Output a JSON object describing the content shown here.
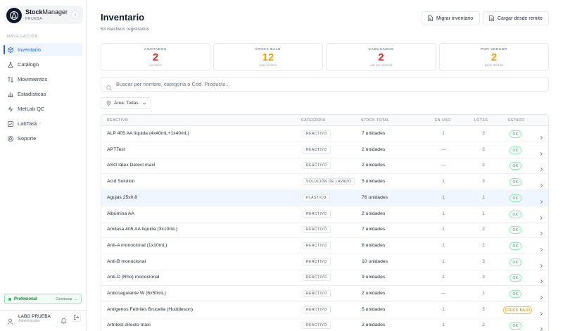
{
  "brand": {
    "name_bold": "Stock",
    "name_rest": "Manager",
    "env": "PRUEBA",
    "collapse_icon": "‹"
  },
  "nav": {
    "heading": "NAVEGACIÓN",
    "items": [
      {
        "label": "Inventario",
        "icon": "cube-icon",
        "active": true
      },
      {
        "label": "Catálogo",
        "icon": "flask-icon",
        "active": false
      },
      {
        "label": "Movimientos",
        "icon": "arrows-icon",
        "active": false
      },
      {
        "label": "Estadísticas",
        "icon": "bar-chart-icon",
        "active": false
      },
      {
        "label": "MetLab QC",
        "icon": "activity-icon",
        "active": false
      },
      {
        "label": "LabTask",
        "icon": "checklist-icon",
        "active": false,
        "external": "↗"
      },
      {
        "label": "Soporte",
        "icon": "lifebuoy-icon",
        "active": false
      }
    ]
  },
  "plan": {
    "name": "Profesional",
    "manage": "Gestionar →",
    "color": "#22c55e"
  },
  "user": {
    "name": "LABO PRUEBA",
    "role": "Administrador"
  },
  "header": {
    "title": "Inventario",
    "subtitle": "63 reactivos registrados",
    "migrate_label": "Migrar inventario",
    "upload_label": "Cargar desde remito"
  },
  "stats": [
    {
      "label": "AGOTADOS",
      "value": "2",
      "hint": "sin stock",
      "color": "#dc2626"
    },
    {
      "label": "STOCK BAJO",
      "value": "12",
      "hint": "bajo mínimo",
      "color": "#f59e0b"
    },
    {
      "label": "CADUCADOS",
      "value": "2",
      "hint": "usa por vencido",
      "color": "#dc2626"
    },
    {
      "label": "POR VENCER",
      "value": "2",
      "hint": "pxos. 30 días",
      "color": "#f59e0b"
    }
  ],
  "search": {
    "placeholder": "Buscar por nombre, categoría o Cód. Producto..."
  },
  "filter": {
    "label": "Área: Todas"
  },
  "table": {
    "headers": {
      "name": "REACTIVO",
      "category": "CATEGORÍA",
      "stock": "STOCK TOTAL",
      "in_use": "EN USO",
      "lots": "LOTES",
      "status": "ESTADO"
    },
    "rows": [
      {
        "name": "ALP 405 AA líquida (4x40mL+1x40mL)",
        "category": "REACTIVO",
        "stock": "7 unidades",
        "in_use": "1",
        "lots": "3",
        "status": "OK",
        "status_type": "ok",
        "highlight": false
      },
      {
        "name": "APTTest",
        "category": "REACTIVO",
        "stock": "2 unidades",
        "in_use": "—",
        "lots": "3",
        "status": "OK",
        "status_type": "ok",
        "highlight": false
      },
      {
        "name": "ASO látex Detect maxi",
        "category": "REACTIVO",
        "stock": "2 unidades",
        "in_use": "—",
        "lots": "2",
        "status": "OK",
        "status_type": "ok",
        "highlight": false
      },
      {
        "name": "Acid Solution",
        "category": "SOLUCIÓN DE LAVADO",
        "stock": "5 unidades",
        "in_use": "1",
        "lots": "3",
        "status": "OK",
        "status_type": "ok",
        "highlight": false
      },
      {
        "name": "Agujas 25x0.8",
        "category": "PLÁSTICO",
        "stock": "76 unidades",
        "in_use": "1",
        "lots": "1",
        "status": "OK",
        "status_type": "ok",
        "highlight": true
      },
      {
        "name": "Albúmina AA",
        "category": "REACTIVO",
        "stock": "2 unidades",
        "in_use": "1",
        "lots": "1",
        "status": "OK",
        "status_type": "ok",
        "highlight": false
      },
      {
        "name": "Amilasa 405 AA líquida (3x10mL)",
        "category": "REACTIVO",
        "stock": "7 unidades",
        "in_use": "1",
        "lots": "2",
        "status": "OK",
        "status_type": "ok",
        "highlight": false
      },
      {
        "name": "Anti-A monoclonal (1x10mL)",
        "category": "REACTIVO",
        "stock": "8 unidades",
        "in_use": "1",
        "lots": "2",
        "status": "OK",
        "status_type": "ok",
        "highlight": false
      },
      {
        "name": "Anti-B monoclonal",
        "category": "REACTIVO",
        "stock": "10 unidades",
        "in_use": "1",
        "lots": "3",
        "status": "OK",
        "status_type": "ok",
        "highlight": false
      },
      {
        "name": "Anti-D (Rho) monoclonal",
        "category": "REACTIVO",
        "stock": "9 unidades",
        "in_use": "1",
        "lots": "3",
        "status": "OK",
        "status_type": "ok",
        "highlight": false
      },
      {
        "name": "Anticoagulante W (6x50mL)",
        "category": "REACTIVO",
        "stock": "2 unidades",
        "in_use": "—",
        "lots": "1",
        "status": "OK",
        "status_type": "ok",
        "highlight": false
      },
      {
        "name": "Antígenos Febriles Brucella (Huddleson)",
        "category": "REACTIVO",
        "stock": "5 unidades",
        "in_use": "1",
        "lots": "3",
        "status": "STOCK BAJO",
        "status_type": "low",
        "highlight": false
      },
      {
        "name": "Artritest directo maxi",
        "category": "REACTIVO",
        "stock": "2 unidades",
        "in_use": "1",
        "lots": "2",
        "status": "OK",
        "status_type": "ok",
        "highlight": false
      }
    ]
  }
}
